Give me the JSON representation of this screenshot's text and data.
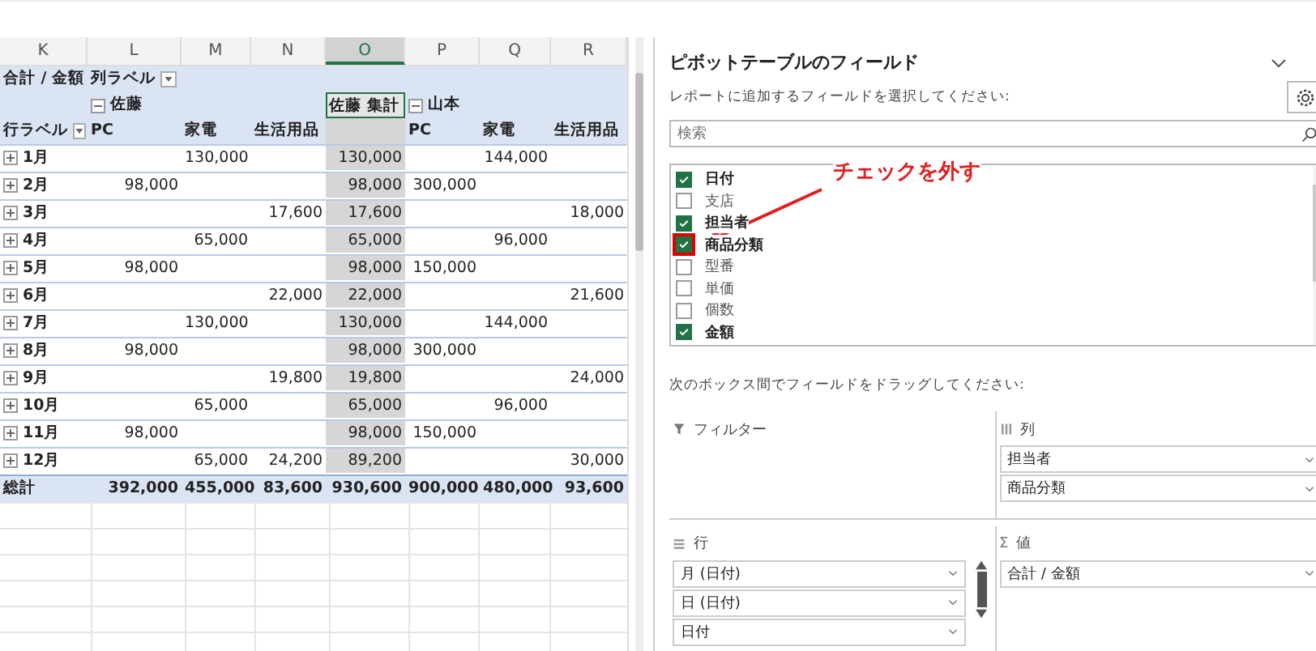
{
  "sheet": {
    "columns": [
      {
        "label": "K",
        "selected": false
      },
      {
        "label": "L",
        "selected": false
      },
      {
        "label": "M",
        "selected": false
      },
      {
        "label": "N",
        "selected": false
      },
      {
        "label": "O",
        "selected": true
      },
      {
        "label": "P",
        "selected": false
      },
      {
        "label": "Q",
        "selected": false
      },
      {
        "label": "R",
        "selected": false
      }
    ]
  },
  "pivot": {
    "value_label": "合計 / 金額",
    "column_labels": "列ラベル",
    "groups": [
      {
        "name": "佐藤",
        "expanded": true,
        "categories": [
          "PC",
          "家電",
          "生活用品"
        ]
      },
      {
        "name": "山本",
        "expanded": true,
        "categories": [
          "PC",
          "家電",
          "生活用品"
        ]
      }
    ],
    "group_total": "佐藤 集計",
    "row_labels": "行ラベル",
    "rows": [
      {
        "label": "1月",
        "M": "130,000",
        "O": "130,000",
        "Q": "144,000"
      },
      {
        "label": "2月",
        "L": "98,000",
        "O": "98,000",
        "P": "300,000"
      },
      {
        "label": "3月",
        "N": "17,600",
        "O": "17,600",
        "R": "18,000"
      },
      {
        "label": "4月",
        "M": "65,000",
        "O": "65,000",
        "Q": "96,000"
      },
      {
        "label": "5月",
        "L": "98,000",
        "O": "98,000",
        "P": "150,000"
      },
      {
        "label": "6月",
        "N": "22,000",
        "O": "22,000",
        "R": "21,600"
      },
      {
        "label": "7月",
        "M": "130,000",
        "O": "130,000",
        "Q": "144,000"
      },
      {
        "label": "8月",
        "L": "98,000",
        "O": "98,000",
        "P": "300,000"
      },
      {
        "label": "9月",
        "N": "19,800",
        "O": "19,800",
        "R": "24,000"
      },
      {
        "label": "10月",
        "M": "65,000",
        "O": "65,000",
        "Q": "96,000"
      },
      {
        "label": "11月",
        "L": "98,000",
        "O": "98,000",
        "P": "150,000"
      },
      {
        "label": "12月",
        "M": "65,000",
        "N": "24,200",
        "O": "89,200",
        "R": "30,000"
      }
    ],
    "total": {
      "label": "総計",
      "L": "392,000",
      "M": "455,000",
      "N": "83,600",
      "O": "930,600",
      "P": "900,000",
      "Q": "480,000",
      "R": "93,600"
    }
  },
  "field_pane": {
    "title": "ピボットテーブルのフィールド",
    "prompt": "レポートに追加するフィールドを選択してください:",
    "search": {
      "placeholder": "検索"
    },
    "fields": [
      {
        "label": "日付",
        "checked": true
      },
      {
        "label": "支店",
        "checked": false
      },
      {
        "label": "担当者",
        "checked": true
      },
      {
        "label": "商品分類",
        "checked": true
      },
      {
        "label": "型番",
        "checked": false
      },
      {
        "label": "単価",
        "checked": false
      },
      {
        "label": "個数",
        "checked": false
      },
      {
        "label": "金額",
        "checked": true
      }
    ],
    "drag_prompt": "次のボックス間でフィールドをドラッグしてください:",
    "areas": [
      {
        "kind": "filter",
        "title": "フィルター"
      },
      {
        "kind": "columns",
        "title": "列",
        "items": [
          "担当者",
          "商品分類"
        ]
      },
      {
        "kind": "rows",
        "title": "行",
        "items": [
          "月 (日付)",
          "日 (日付)",
          "日付"
        ]
      },
      {
        "kind": "values",
        "icon": "Σ",
        "title": "値",
        "items": [
          "合計 / 金額"
        ]
      }
    ]
  },
  "annotation": {
    "text": "チェックを外す"
  }
}
